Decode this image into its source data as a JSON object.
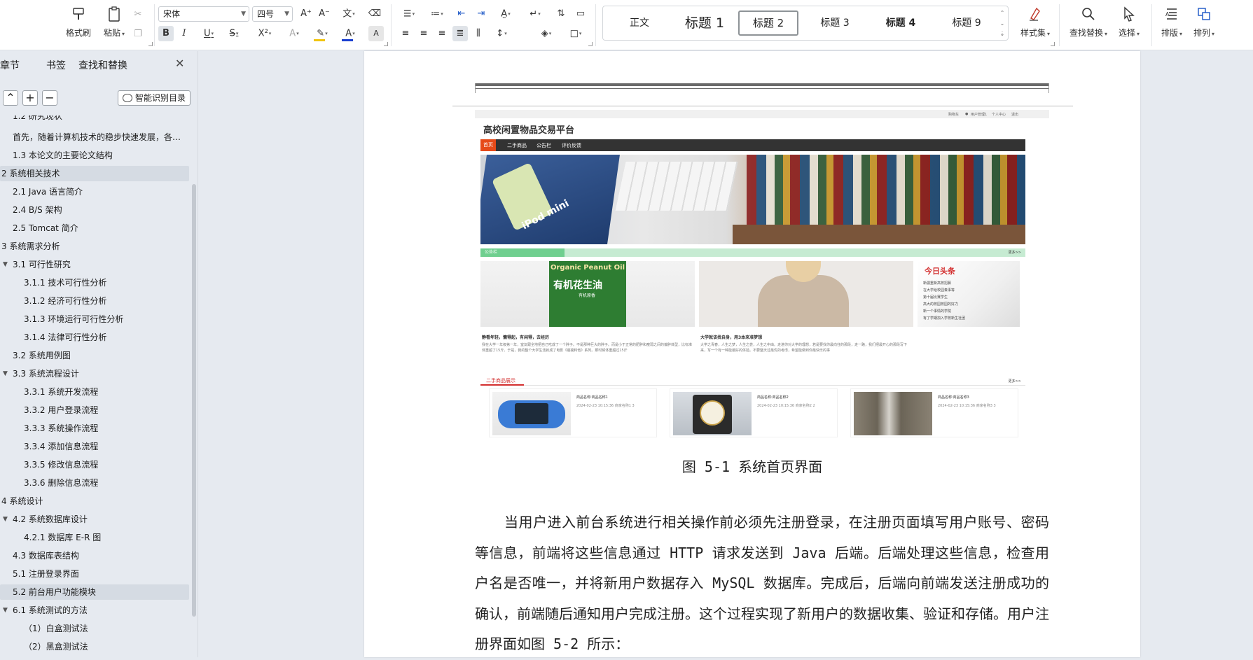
{
  "ribbon": {
    "clipboard": {
      "format_painter": "格式刷",
      "paste": "粘贴"
    },
    "font": {
      "name": "宋体",
      "size": "四号",
      "bold": "B",
      "italic": "I",
      "underline": "U",
      "strike": "S",
      "superscript": "X²",
      "highlight_color": "#f1c40f",
      "font_color": "#1a3fd0"
    },
    "styles": {
      "items": [
        "正文",
        "标题 1",
        "标题 2",
        "标题 3",
        "标题 4",
        "标题 9"
      ],
      "selected": "标题 2"
    },
    "style_set": "样式集",
    "find_replace": "查找替换",
    "select": "选择",
    "layout": "排版",
    "arrange": "排列"
  },
  "nav": {
    "tabs": [
      "章节",
      "书签",
      "查找和替换"
    ],
    "smart_toc": "智能识别目录",
    "items": [
      {
        "text": "1.2 研究现状",
        "indent": 1,
        "hl": false,
        "tri": false
      },
      {
        "text": "首先，随着计算机技术的稳步快速发展，各行各业",
        "indent": 1,
        "hl": false,
        "tri": false
      },
      {
        "text": "1.3 本论文的主要论文结构",
        "indent": 1,
        "hl": false,
        "tri": false
      },
      {
        "text": "2 系统相关技术",
        "indent": 0,
        "hl": true,
        "tri": false
      },
      {
        "text": "2.1 Java 语言简介",
        "indent": 1,
        "hl": false,
        "tri": false
      },
      {
        "text": "2.4 B/S 架构",
        "indent": 1,
        "hl": false,
        "tri": false
      },
      {
        "text": "2.5 Tomcat 简介",
        "indent": 1,
        "hl": false,
        "tri": false
      },
      {
        "text": "3 系统需求分析",
        "indent": 0,
        "hl": false,
        "tri": false
      },
      {
        "text": "3.1 可行性研究",
        "indent": 1,
        "hl": false,
        "tri": true
      },
      {
        "text": "3.1.1 技术可行性分析",
        "indent": 2,
        "hl": false,
        "tri": false
      },
      {
        "text": "3.1.2  经济可行性分析",
        "indent": 2,
        "hl": false,
        "tri": false
      },
      {
        "text": "3.1.3  环境运行可行性分析",
        "indent": 2,
        "hl": false,
        "tri": false
      },
      {
        "text": "3.1.4  法律可行性分析",
        "indent": 2,
        "hl": false,
        "tri": false
      },
      {
        "text": "3.2 系统用例图",
        "indent": 1,
        "hl": false,
        "tri": false
      },
      {
        "text": "3.3 系统流程设计",
        "indent": 1,
        "hl": false,
        "tri": true
      },
      {
        "text": "3.3.1  系统开发流程",
        "indent": 2,
        "hl": false,
        "tri": false
      },
      {
        "text": "3.3.2  用户登录流程",
        "indent": 2,
        "hl": false,
        "tri": false
      },
      {
        "text": "3.3.3  系统操作流程",
        "indent": 2,
        "hl": false,
        "tri": false
      },
      {
        "text": "3.3.4  添加信息流程",
        "indent": 2,
        "hl": false,
        "tri": false
      },
      {
        "text": "3.3.5  修改信息流程",
        "indent": 2,
        "hl": false,
        "tri": false
      },
      {
        "text": "3.3.6  删除信息流程",
        "indent": 2,
        "hl": false,
        "tri": false
      },
      {
        "text": "4 系统设计",
        "indent": 0,
        "hl": false,
        "tri": false
      },
      {
        "text": "4.2 系统数据库设计",
        "indent": 1,
        "hl": false,
        "tri": true
      },
      {
        "text": "4.2.1 数据库 E-R 图",
        "indent": 2,
        "hl": false,
        "tri": false
      },
      {
        "text": "4.3 数据库表结构",
        "indent": 1,
        "hl": false,
        "tri": false
      },
      {
        "text": "5.1 注册登录界面",
        "indent": 1,
        "hl": false,
        "tri": false
      },
      {
        "text": "5.2 前台用户功能模块",
        "indent": 1,
        "hl": true,
        "tri": false
      },
      {
        "text": "6.1 系统测试的方法",
        "indent": 1,
        "hl": false,
        "tri": true
      },
      {
        "text": "（1）白盒测试法",
        "indent": 2,
        "hl": false,
        "tri": false
      },
      {
        "text": "（2）黑盒测试法",
        "indent": 2,
        "hl": false,
        "tri": false
      }
    ]
  },
  "screenshot": {
    "topbar": [
      "购物车",
      "用户管理1",
      "个人中心",
      "退出"
    ],
    "title": "高校闲置物品交易平台",
    "menu": [
      "首页",
      "二手商品",
      "公告栏",
      "评价反馈"
    ],
    "banner_text": "iPod mini",
    "notice_label": "公告栏",
    "more": "更多>>",
    "oil_label_en": "Organic Peanut Oil",
    "oil_label_cn": "有机花生油",
    "oil_label_sub": "有机原香",
    "card1_title": "静看年轻，慵得起，有闲得，去经历",
    "card1_text": "我在大学一年级第一年，室友跟全地把自己吃成了一个胖子。不是那种巨大的胖子。而是小于正常的肥胖和瘦弱之间的偏胖体型，比标准体重超了15斤。于是，我的整个大学生活就成了电影《瘦瘦和他》系列。那时候体重超过15斤",
    "card2_title": "大学就该找自身，用3本来准梦想",
    "card2_text": "大学之青春，人生之梦，人生之尝，人生之中由。走进你对大学的理想，若是要找你最向往的那段，走一路，我们把最开心的那段写下来，写一个有一种能最好的体验。不要整天过最优的考虑，希望能做到你最快乐的事",
    "headline_title": "今日头条",
    "headlines": [
      "新疆重新高校招募",
      "在大学给校园奏事等",
      "第十届比赛学生",
      "高大的校园校园的好力",
      "新一个事情的学院",
      "有了学期加入学校新生社团"
    ],
    "goods_label": "二手商品展示",
    "goods": [
      {
        "name": "商品名称:商品名称1",
        "meta": "2024-02-23 10:15:36    商家名称1    3"
      },
      {
        "name": "商品名称:商品名称2",
        "meta": "2024-02-23 10:15:36    商家名称2    2"
      },
      {
        "name": "商品名称:商品名称3",
        "meta": "2024-02-23 10:15:36    商家名称3    3"
      }
    ]
  },
  "document": {
    "figure_caption": "图 5-1  系统首页界面",
    "paragraph": "当用户进入前台系统进行相关操作前必须先注册登录，在注册页面填写用户账号、密码等信息，前端将这些信息通过 HTTP 请求发送到 Java 后端。后端处理这些信息，检查用户名是否唯一，并将新用户数据存入 MySQL 数据库。完成后，后端向前端发送注册成功的确认，前端随后通知用户完成注册。这个过程实现了新用户的数据收集、验证和存储。用户注册界面如图 5-2 所示："
  }
}
